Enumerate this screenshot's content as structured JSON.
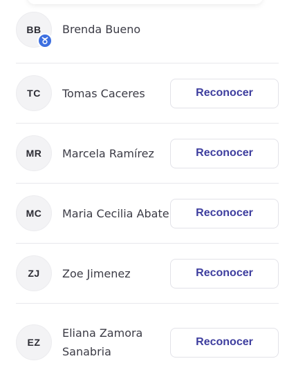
{
  "colors": {
    "button_text": "#3d3d9e",
    "badge": "#3d6fe0",
    "divider": "#e8e8ec"
  },
  "people": [
    {
      "initials": "BB",
      "name": "Brenda Bueno",
      "badge_icon": "taurus-icon"
    },
    {
      "initials": "TC",
      "name": "Tomas Caceres",
      "button_label": "Reconocer"
    },
    {
      "initials": "MR",
      "name": "Marcela Ramírez",
      "button_label": "Reconocer"
    },
    {
      "initials": "MC",
      "name": "Maria Cecilia Abate",
      "button_label": "Reconocer"
    },
    {
      "initials": "ZJ",
      "name": "Zoe Jimenez",
      "button_label": "Reconocer"
    },
    {
      "initials": "EZ",
      "name": "Eliana Zamora Sanabria",
      "button_label": "Reconocer"
    }
  ]
}
